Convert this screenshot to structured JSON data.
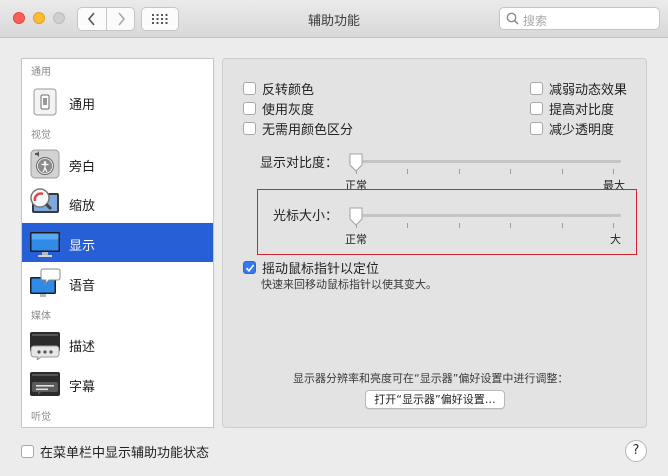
{
  "window": {
    "title": "辅助功能"
  },
  "search": {
    "placeholder": "搜索"
  },
  "sidebar": {
    "sections": [
      {
        "header": "通用"
      },
      {
        "header": "视觉"
      },
      {
        "header": "媒体"
      },
      {
        "header": "听觉"
      }
    ],
    "items": [
      {
        "label": "通用",
        "icon": "general-icon"
      },
      {
        "label": "旁白",
        "icon": "voiceover-icon"
      },
      {
        "label": "缩放",
        "icon": "zoom-icon"
      },
      {
        "label": "显示",
        "icon": "display-icon",
        "selected": true
      },
      {
        "label": "语音",
        "icon": "speech-icon"
      },
      {
        "label": "描述",
        "icon": "descriptions-icon"
      },
      {
        "label": "字幕",
        "icon": "captions-icon"
      }
    ]
  },
  "options": {
    "invert": {
      "label": "反转颜色",
      "checked": false
    },
    "grayscale": {
      "label": "使用灰度",
      "checked": false
    },
    "differentiate": {
      "label": "无需用颜色区分",
      "checked": false
    },
    "reduce_motion": {
      "label": "减弱动态效果",
      "checked": false
    },
    "increase_contrast": {
      "label": "提高对比度",
      "checked": false
    },
    "reduce_transparency": {
      "label": "减少透明度",
      "checked": false
    }
  },
  "contrast_slider": {
    "label": "显示对比度：",
    "min_label": "正常",
    "max_label": "最大",
    "value": 0
  },
  "cursor_slider": {
    "label": "光标大小：",
    "min_label": "正常",
    "max_label": "大",
    "value": 0
  },
  "shake_option": {
    "label": "摇动鼠标指针以定位",
    "checked": true,
    "description": "快速来回移动鼠标指针以使其变大。"
  },
  "display_note": "显示器分辨率和亮度可在“显示器”偏好设置中进行调整：",
  "open_display_button": "打开“显示器”偏好设置…",
  "menubar_status": {
    "label": "在菜单栏中显示辅助功能状态",
    "checked": false
  },
  "help_label": "?",
  "colors": {
    "selection": "#2760d6",
    "checkbox_on": "#3479f0",
    "highlight_box": "#d0262f"
  }
}
